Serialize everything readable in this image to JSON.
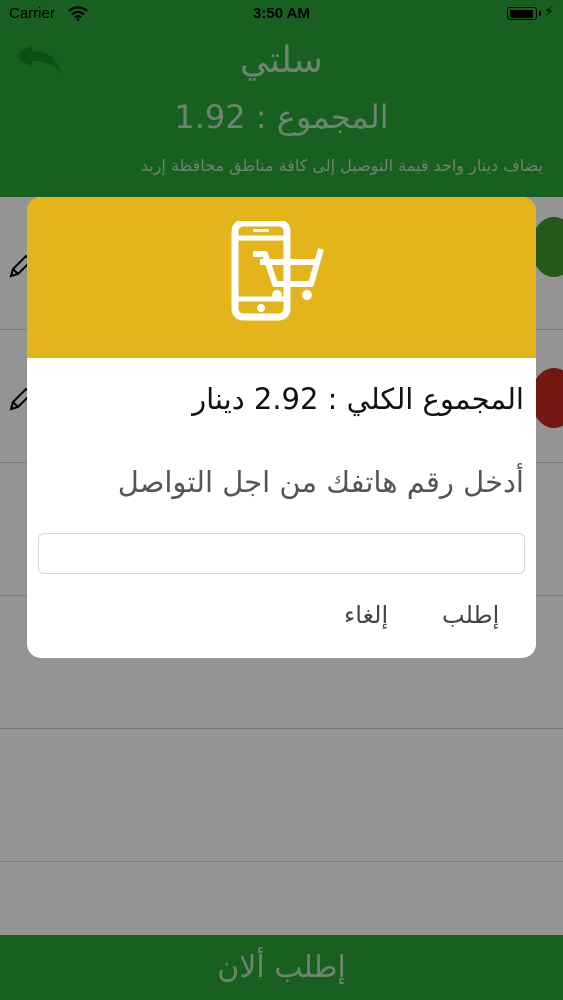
{
  "status_bar": {
    "carrier": "Carrier",
    "time": "3:50 AM"
  },
  "header": {
    "title": "سلتي",
    "total": "المجموع : 1.92",
    "note": "يضاف دينار واحد قيمة التوصيل إلى كافة مناطق محافظة إربد"
  },
  "bottom_button": {
    "label": "إطلب ألان"
  },
  "dialog": {
    "total_text": "المجموع الكلي : 2.92 دينار",
    "prompt": "أدخل رقم هاتفك من اجل التواصل",
    "phone_value": "",
    "order_label": "إطلب",
    "cancel_label": "إلغاء"
  },
  "colors": {
    "brand_green": "#28a637",
    "dialog_header": "#e3b51a",
    "icons": [
      "back-arrow-icon",
      "pencil-icon",
      "phone-cart-icon",
      "wifi-icon",
      "battery-icon"
    ]
  }
}
